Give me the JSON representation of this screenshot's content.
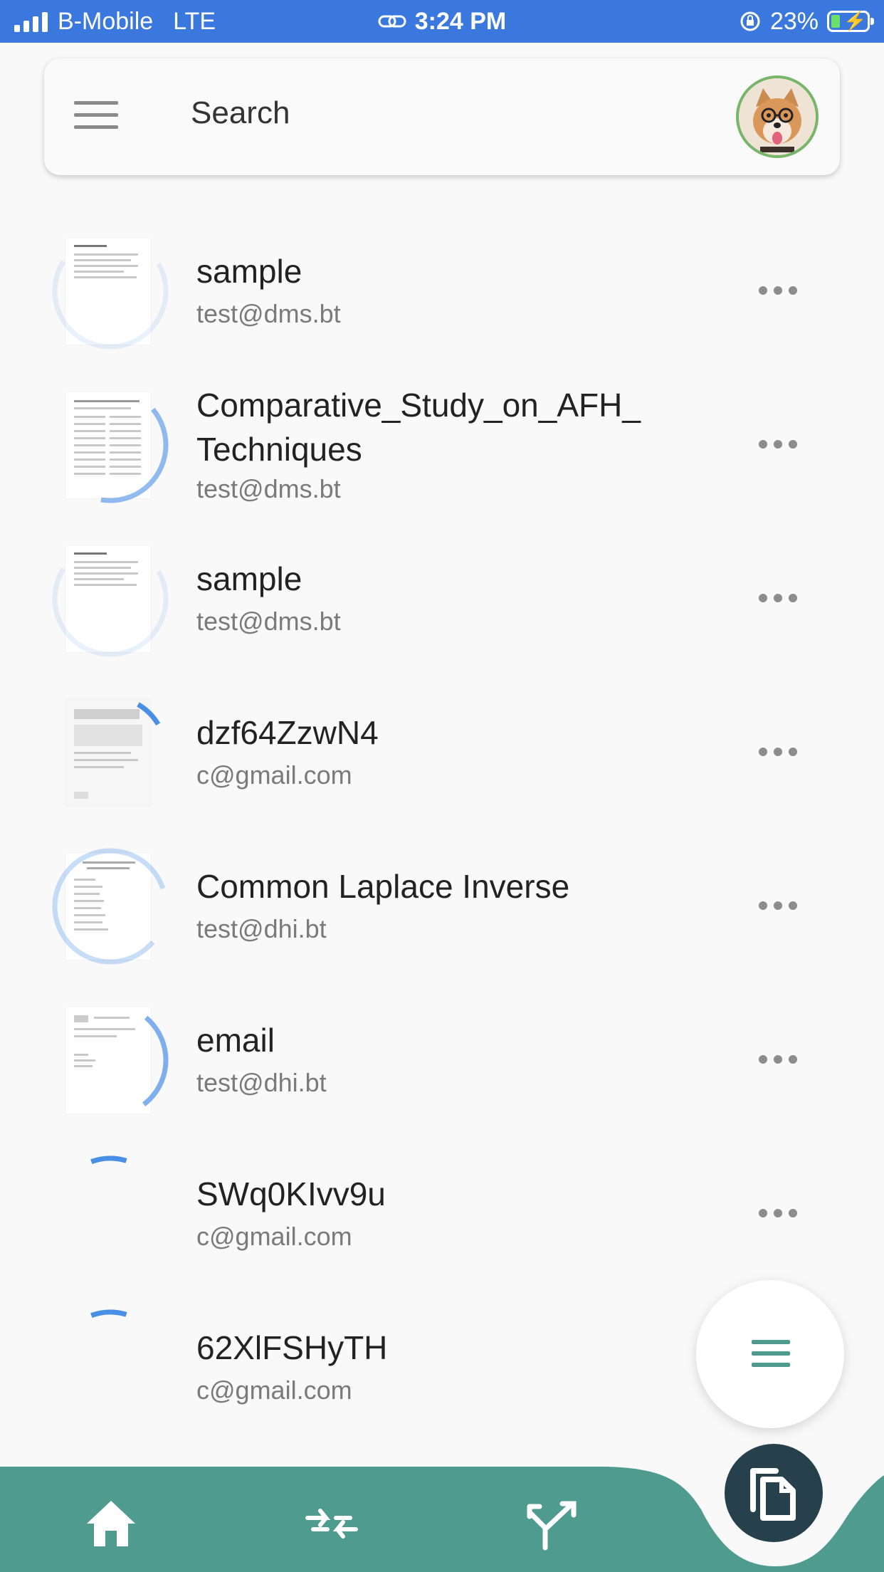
{
  "status_bar": {
    "carrier": "B-Mobile",
    "network": "LTE",
    "time": "3:24 PM",
    "battery_percent": "23%",
    "battery_level": 0.23,
    "icons": [
      "signal-icon",
      "link-icon",
      "orientation-lock-icon",
      "battery-charging-icon"
    ]
  },
  "search": {
    "placeholder": "Search",
    "menu_icon": "hamburger-menu-icon",
    "avatar": "profile-avatar"
  },
  "documents": [
    {
      "title": "sample",
      "owner": "test@dms.bt"
    },
    {
      "title": "Comparative_Study_on_AFH_ Techniques",
      "title_line1": "Comparative_Study_on_AFH_",
      "title_line2": "Techniques",
      "owner": "test@dms.bt"
    },
    {
      "title": "sample",
      "owner": "test@dms.bt"
    },
    {
      "title": "dzf64ZzwN4",
      "owner": "c@gmail.com"
    },
    {
      "title": "Common Laplace Inverse",
      "owner": "test@dhi.bt"
    },
    {
      "title": "email",
      "owner": "test@dhi.bt"
    },
    {
      "title": "SWq0KIvv9u",
      "owner": "c@gmail.com"
    },
    {
      "title": "62XlFSHyTH",
      "owner": "c@gmail.com"
    }
  ],
  "more_icon": "more-horizontal-icon",
  "fab": {
    "icon": "menu-lines-icon"
  },
  "bottom_nav": {
    "items": [
      "home-icon",
      "merge-icon",
      "split-icon"
    ],
    "active": "documents-icon"
  },
  "colors": {
    "status_bar": "#3b78de",
    "accent": "#4f9b8f",
    "nav_dark": "#27414c",
    "avatar_ring": "#76b66b",
    "spinner": "#4a8fe6"
  }
}
